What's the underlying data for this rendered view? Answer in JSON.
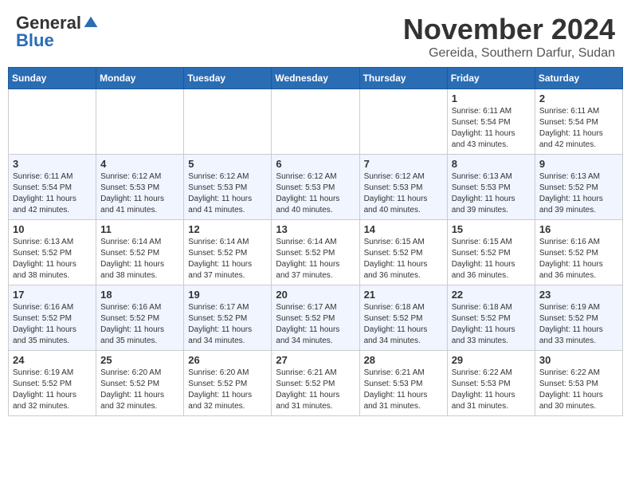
{
  "header": {
    "logo": {
      "general": "General",
      "blue": "Blue"
    },
    "month": "November 2024",
    "location": "Gereida, Southern Darfur, Sudan"
  },
  "days_of_week": [
    "Sunday",
    "Monday",
    "Tuesday",
    "Wednesday",
    "Thursday",
    "Friday",
    "Saturday"
  ],
  "weeks": [
    {
      "days": [
        {
          "num": "",
          "info": ""
        },
        {
          "num": "",
          "info": ""
        },
        {
          "num": "",
          "info": ""
        },
        {
          "num": "",
          "info": ""
        },
        {
          "num": "",
          "info": ""
        },
        {
          "num": "1",
          "info": "Sunrise: 6:11 AM\nSunset: 5:54 PM\nDaylight: 11 hours\nand 43 minutes."
        },
        {
          "num": "2",
          "info": "Sunrise: 6:11 AM\nSunset: 5:54 PM\nDaylight: 11 hours\nand 42 minutes."
        }
      ]
    },
    {
      "days": [
        {
          "num": "3",
          "info": "Sunrise: 6:11 AM\nSunset: 5:54 PM\nDaylight: 11 hours\nand 42 minutes."
        },
        {
          "num": "4",
          "info": "Sunrise: 6:12 AM\nSunset: 5:53 PM\nDaylight: 11 hours\nand 41 minutes."
        },
        {
          "num": "5",
          "info": "Sunrise: 6:12 AM\nSunset: 5:53 PM\nDaylight: 11 hours\nand 41 minutes."
        },
        {
          "num": "6",
          "info": "Sunrise: 6:12 AM\nSunset: 5:53 PM\nDaylight: 11 hours\nand 40 minutes."
        },
        {
          "num": "7",
          "info": "Sunrise: 6:12 AM\nSunset: 5:53 PM\nDaylight: 11 hours\nand 40 minutes."
        },
        {
          "num": "8",
          "info": "Sunrise: 6:13 AM\nSunset: 5:53 PM\nDaylight: 11 hours\nand 39 minutes."
        },
        {
          "num": "9",
          "info": "Sunrise: 6:13 AM\nSunset: 5:52 PM\nDaylight: 11 hours\nand 39 minutes."
        }
      ]
    },
    {
      "days": [
        {
          "num": "10",
          "info": "Sunrise: 6:13 AM\nSunset: 5:52 PM\nDaylight: 11 hours\nand 38 minutes."
        },
        {
          "num": "11",
          "info": "Sunrise: 6:14 AM\nSunset: 5:52 PM\nDaylight: 11 hours\nand 38 minutes."
        },
        {
          "num": "12",
          "info": "Sunrise: 6:14 AM\nSunset: 5:52 PM\nDaylight: 11 hours\nand 37 minutes."
        },
        {
          "num": "13",
          "info": "Sunrise: 6:14 AM\nSunset: 5:52 PM\nDaylight: 11 hours\nand 37 minutes."
        },
        {
          "num": "14",
          "info": "Sunrise: 6:15 AM\nSunset: 5:52 PM\nDaylight: 11 hours\nand 36 minutes."
        },
        {
          "num": "15",
          "info": "Sunrise: 6:15 AM\nSunset: 5:52 PM\nDaylight: 11 hours\nand 36 minutes."
        },
        {
          "num": "16",
          "info": "Sunrise: 6:16 AM\nSunset: 5:52 PM\nDaylight: 11 hours\nand 36 minutes."
        }
      ]
    },
    {
      "days": [
        {
          "num": "17",
          "info": "Sunrise: 6:16 AM\nSunset: 5:52 PM\nDaylight: 11 hours\nand 35 minutes."
        },
        {
          "num": "18",
          "info": "Sunrise: 6:16 AM\nSunset: 5:52 PM\nDaylight: 11 hours\nand 35 minutes."
        },
        {
          "num": "19",
          "info": "Sunrise: 6:17 AM\nSunset: 5:52 PM\nDaylight: 11 hours\nand 34 minutes."
        },
        {
          "num": "20",
          "info": "Sunrise: 6:17 AM\nSunset: 5:52 PM\nDaylight: 11 hours\nand 34 minutes."
        },
        {
          "num": "21",
          "info": "Sunrise: 6:18 AM\nSunset: 5:52 PM\nDaylight: 11 hours\nand 34 minutes."
        },
        {
          "num": "22",
          "info": "Sunrise: 6:18 AM\nSunset: 5:52 PM\nDaylight: 11 hours\nand 33 minutes."
        },
        {
          "num": "23",
          "info": "Sunrise: 6:19 AM\nSunset: 5:52 PM\nDaylight: 11 hours\nand 33 minutes."
        }
      ]
    },
    {
      "days": [
        {
          "num": "24",
          "info": "Sunrise: 6:19 AM\nSunset: 5:52 PM\nDaylight: 11 hours\nand 32 minutes."
        },
        {
          "num": "25",
          "info": "Sunrise: 6:20 AM\nSunset: 5:52 PM\nDaylight: 11 hours\nand 32 minutes."
        },
        {
          "num": "26",
          "info": "Sunrise: 6:20 AM\nSunset: 5:52 PM\nDaylight: 11 hours\nand 32 minutes."
        },
        {
          "num": "27",
          "info": "Sunrise: 6:21 AM\nSunset: 5:52 PM\nDaylight: 11 hours\nand 31 minutes."
        },
        {
          "num": "28",
          "info": "Sunrise: 6:21 AM\nSunset: 5:53 PM\nDaylight: 11 hours\nand 31 minutes."
        },
        {
          "num": "29",
          "info": "Sunrise: 6:22 AM\nSunset: 5:53 PM\nDaylight: 11 hours\nand 31 minutes."
        },
        {
          "num": "30",
          "info": "Sunrise: 6:22 AM\nSunset: 5:53 PM\nDaylight: 11 hours\nand 30 minutes."
        }
      ]
    }
  ]
}
